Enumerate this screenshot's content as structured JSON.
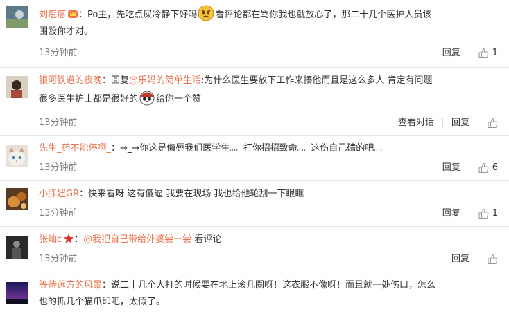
{
  "comments": [
    {
      "user": "刘疙瘩",
      "text_a": "：Po主，先吃点屎冷静下好吗",
      "text_b": "看评论都在骂你我也就放心了，那二十几个医护人员该",
      "text_c": "围殴你才对。",
      "time": "13分钟前",
      "reply": "回复",
      "likes": "1"
    },
    {
      "user": "银河铁道的夜晚",
      "text_a": "：回复",
      "mention": "@乐妈的简单生活",
      "text_b": ":为什么医生要放下工作来揍他而且是这么多人 肯定有问题",
      "text_c": "很多医生护士都是很好的",
      "text_d": "给你一个赞",
      "time": "13分钟前",
      "view_conversation": "查看对话",
      "reply": "回复",
      "likes": ""
    },
    {
      "user": "先生_药不能停啊_",
      "text_a": "：→_→你这是侮辱我们医学生。。打你招招致命。。这伤自己磕的吧。。",
      "time": "13分钟前",
      "reply": "回复",
      "likes": "6"
    },
    {
      "user": "小胖妞GR",
      "text_a": "：快来看呀 这有傻逼 我要在现场 我也给他轮刮一下眼眶",
      "time": "13分钟前",
      "reply": "回复",
      "likes": "1"
    },
    {
      "user": "张灿c",
      "text_a": "：",
      "mention": "@我把自己带给外婆尝一尝",
      "text_b": " 看评论",
      "time": "13分钟前",
      "reply": "回复",
      "likes": ""
    },
    {
      "user": "等待远方的风景",
      "text_a": "：说二十几个人打的时候要在地上滚几圈呀！这衣服不像呀！而且就一处伤口，怎么",
      "text_c": "也的抓几个猫爪印吧，太假了。"
    }
  ]
}
